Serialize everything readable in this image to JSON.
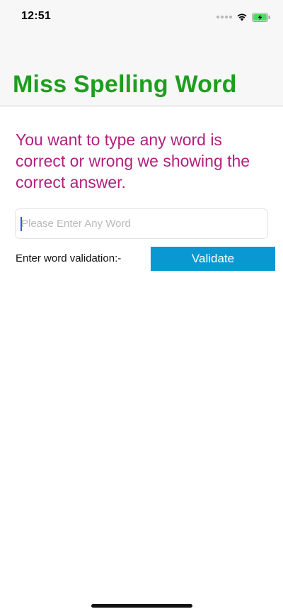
{
  "status_bar": {
    "time": "12:51",
    "icons": [
      "signal-dots-icon",
      "wifi-icon",
      "battery-charging-icon"
    ]
  },
  "nav": {
    "title": "Miss Spelling Word"
  },
  "main": {
    "description": "You want to type any word is correct or wrong we showing the correct answer.",
    "word_input": {
      "placeholder": "Please Enter Any Word",
      "value": ""
    },
    "validation_label": "Enter word validation:-",
    "validate_button_label": "Validate"
  },
  "colors": {
    "title": "#1f9d1f",
    "description": "#b21f7e",
    "button": "#0a98d3",
    "battery": "#4cd964"
  }
}
